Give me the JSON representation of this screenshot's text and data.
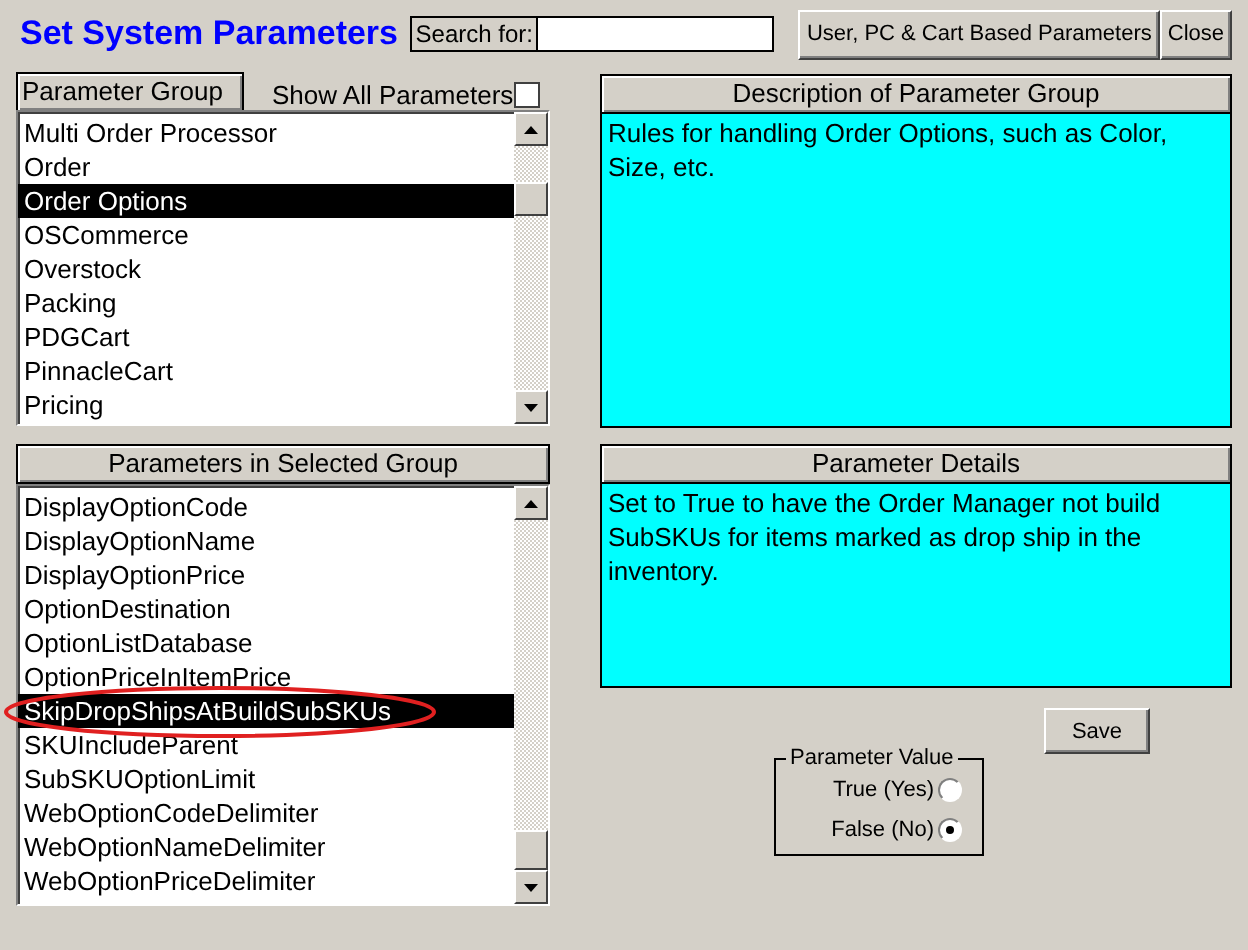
{
  "title": "Set System Parameters",
  "search": {
    "label": "Search for:"
  },
  "buttons": [
    "User, PC & Cart Based Parameters",
    "Close"
  ],
  "parameter_group": {
    "header": "Parameter Group",
    "show_all": {
      "label": "Show All Parameters",
      "checked": false
    },
    "items": [
      {
        "label": "Multi Order Processor",
        "selected": false
      },
      {
        "label": "Order",
        "selected": false
      },
      {
        "label": "Order Options",
        "selected": true
      },
      {
        "label": "OSCommerce",
        "selected": false
      },
      {
        "label": "Overstock",
        "selected": false
      },
      {
        "label": "Packing",
        "selected": false
      },
      {
        "label": "PDGCart",
        "selected": false
      },
      {
        "label": "PinnacleCart",
        "selected": false
      },
      {
        "label": "Pricing",
        "selected": false
      }
    ]
  },
  "description": {
    "header": "Description of Parameter Group",
    "text": "Rules for handling Order Options, such as Color, Size, etc."
  },
  "parameters": {
    "header": "Parameters in Selected Group",
    "items": [
      {
        "label": "DisplayOptionCode",
        "selected": false,
        "circled": false
      },
      {
        "label": "DisplayOptionName",
        "selected": false,
        "circled": false
      },
      {
        "label": "DisplayOptionPrice",
        "selected": false,
        "circled": false
      },
      {
        "label": "OptionDestination",
        "selected": false,
        "circled": false
      },
      {
        "label": "OptionListDatabase",
        "selected": false,
        "circled": false
      },
      {
        "label": "OptionPriceInItemPrice",
        "selected": false,
        "circled": false
      },
      {
        "label": "SkipDropShipsAtBuildSubSKUs",
        "selected": true,
        "circled": true
      },
      {
        "label": "SKUIncludeParent",
        "selected": false,
        "circled": false
      },
      {
        "label": "SubSKUOptionLimit",
        "selected": false,
        "circled": false
      },
      {
        "label": "WebOptionCodeDelimiter",
        "selected": false,
        "circled": false
      },
      {
        "label": "WebOptionNameDelimiter",
        "selected": false,
        "circled": false
      },
      {
        "label": "WebOptionPriceDelimiter",
        "selected": false,
        "circled": false
      }
    ]
  },
  "details": {
    "header": "Parameter Details",
    "text": "Set to True to have the Order Manager not build SubSKUs for items marked as drop ship in the inventory."
  },
  "save": "Save",
  "parameter_value": {
    "legend": "Parameter Value",
    "options": [
      {
        "label": "True (Yes)",
        "selected": false
      },
      {
        "label": "False (No)",
        "selected": true
      }
    ]
  }
}
